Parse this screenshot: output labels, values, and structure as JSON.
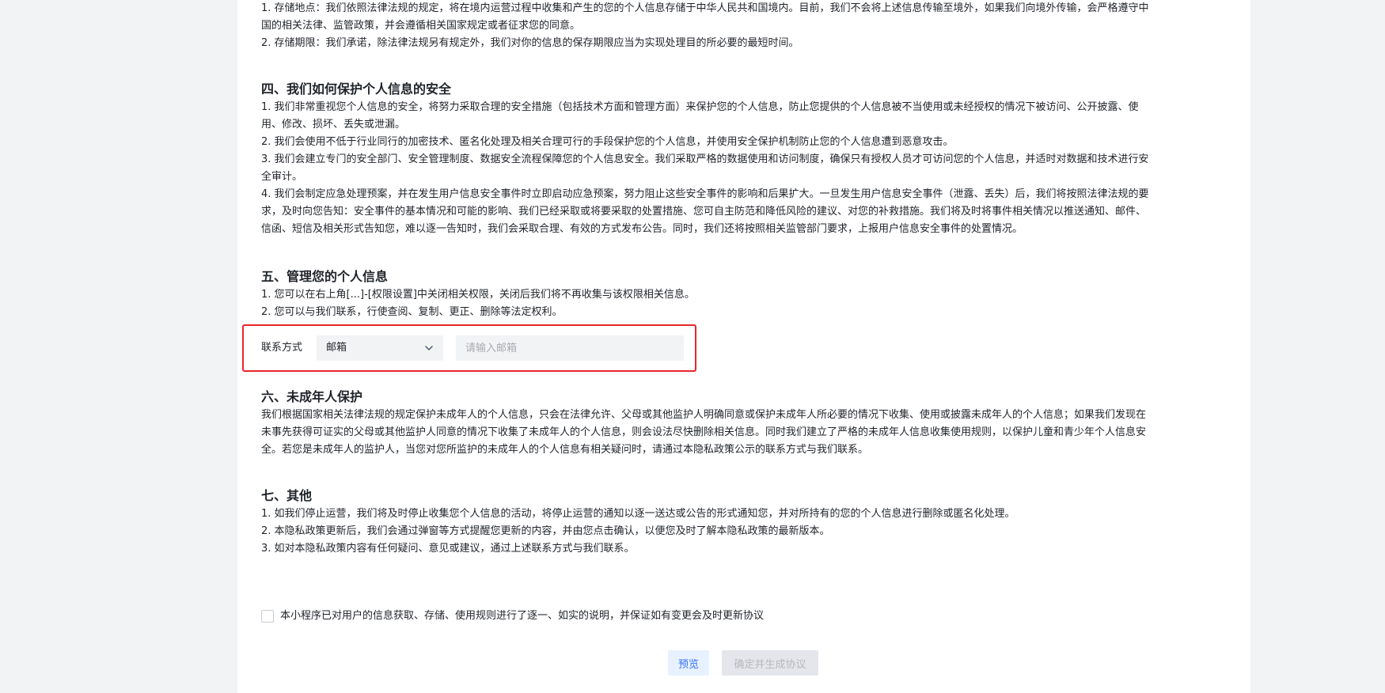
{
  "section3": {
    "lines": [
      "1. 存储地点：我们依照法律法规的规定，将在境内运营过程中收集和产生的您的个人信息存储于中华人民共和国境内。目前，我们不会将上述信息传输至境外，如果我们向境外传输，会严格遵守中",
      "国的相关法律、监管政策，并会遵循相关国家规定或者征求您的同意。",
      "2. 存储期限：我们承诺，除法律法规另有规定外，我们对你的信息的保存期限应当为实现处理目的所必要的最短时间。"
    ]
  },
  "section4": {
    "title": "四、我们如何保护个人信息的安全",
    "lines": [
      "1. 我们非常重视您个人信息的安全，将努力采取合理的安全措施（包括技术方面和管理方面）来保护您的个人信息，防止您提供的个人信息被不当使用或未经授权的情况下被访问、公开披露、使",
      "用、修改、损坏、丢失或泄漏。",
      "2. 我们会使用不低于行业同行的加密技术、匿名化处理及相关合理可行的手段保护您的个人信息，并使用安全保护机制防止您的个人信息遭到恶意攻击。",
      "3. 我们会建立专门的安全部门、安全管理制度、数据安全流程保障您的个人信息安全。我们采取严格的数据使用和访问制度，确保只有授权人员才可访问您的个人信息，并适时对数据和技术进行安",
      "全审计。",
      "4. 我们会制定应急处理预案，并在发生用户信息安全事件时立即启动应急预案，努力阻止这些安全事件的影响和后果扩大。一旦发生用户信息安全事件（泄露、丢失）后，我们将按照法律法规的要",
      "求，及时向您告知：安全事件的基本情况和可能的影响、我们已经采取或将要采取的处置措施、您可自主防范和降低风险的建议、对您的补救措施。我们将及时将事件相关情况以推送通知、邮件、",
      "信函、短信及相关形式告知您，难以逐一告知时，我们会采取合理、有效的方式发布公告。同时，我们还将按照相关监管部门要求，上报用户信息安全事件的处置情况。"
    ]
  },
  "section5": {
    "title": "五、管理您的个人信息",
    "lines": [
      "1. 您可以在右上角[...]-[权限设置]中关闭相关权限，关闭后我们将不再收集与该权限相关信息。",
      "2. 您可以与我们联系，行使查阅、复制、更正、删除等法定权利。"
    ],
    "contact": {
      "label": "联系方式",
      "selected": "邮箱",
      "placeholder": "请输入邮箱",
      "value": ""
    }
  },
  "section6": {
    "title": "六、未成年人保护",
    "lines": [
      "我们根据国家相关法律法规的规定保护未成年人的个人信息，只会在法律允许、父母或其他监护人明确同意或保护未成年人所必要的情况下收集、使用或披露未成年人的个人信息；如果我们发现在",
      "未事先获得可证实的父母或其他监护人同意的情况下收集了未成年人的个人信息，则会设法尽快删除相关信息。同时我们建立了严格的未成年人信息收集使用规则，以保护儿童和青少年个人信息安",
      "全。若您是未成年人的监护人，当您对您所监护的未成年人的个人信息有相关疑问时，请通过本隐私政策公示的联系方式与我们联系。"
    ]
  },
  "section7": {
    "title": "七、其他",
    "lines": [
      "1. 如我们停止运营，我们将及时停止收集您个人信息的活动，将停止运营的通知以逐一送达或公告的形式通知您，并对所持有的您的个人信息进行删除或匿名化处理。",
      "2. 本隐私政策更新后，我们会通过弹窗等方式提醒您更新的内容，并由您点击确认，以便您及时了解本隐私政策的最新版本。",
      "3. 如对本隐私政策内容有任何疑问、意见或建议，通过上述联系方式与我们联系。"
    ]
  },
  "agreement": {
    "text": "本小程序已对用户的信息获取、存储、使用规则进行了逐一、如实的说明，并保证如有变更会及时更新协议",
    "checked": false
  },
  "buttons": {
    "preview": "预览",
    "confirm": "确定并生成协议"
  }
}
